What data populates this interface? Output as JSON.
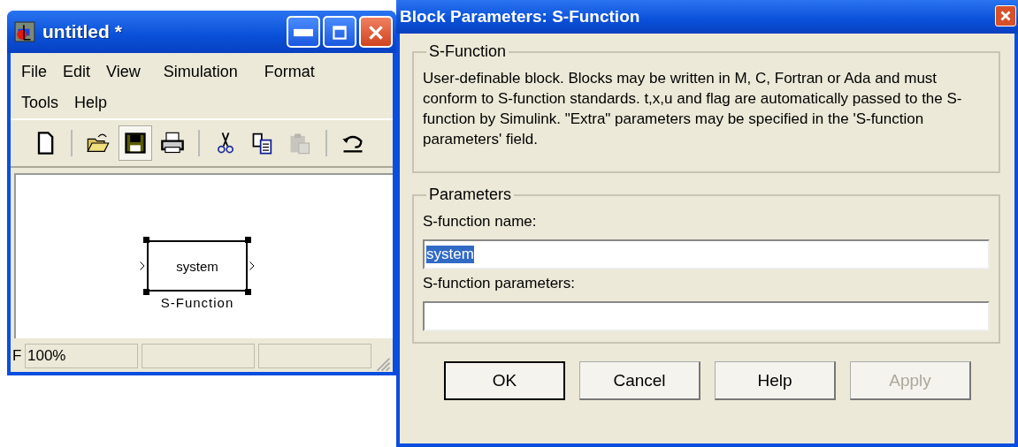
{
  "model_window": {
    "title": "untitled *",
    "menu_rows": [
      [
        "File",
        "Edit",
        "View",
        "Simulation",
        "Format"
      ],
      [
        "Tools",
        "Help"
      ]
    ],
    "toolbar": [
      {
        "kind": "new",
        "pressed": false,
        "disabled": false
      },
      {
        "kind": "separator"
      },
      {
        "kind": "open",
        "pressed": false,
        "disabled": false
      },
      {
        "kind": "save",
        "pressed": true,
        "disabled": false
      },
      {
        "kind": "print",
        "pressed": false,
        "disabled": false
      },
      {
        "kind": "separator"
      },
      {
        "kind": "cut",
        "pressed": false,
        "disabled": false
      },
      {
        "kind": "copy",
        "pressed": false,
        "disabled": false
      },
      {
        "kind": "paste",
        "pressed": false,
        "disabled": true
      },
      {
        "kind": "separator"
      },
      {
        "kind": "undo",
        "pressed": false,
        "disabled": false
      }
    ],
    "block": {
      "text": "system",
      "label": "S-Function",
      "selected": true
    },
    "status_bar": [
      "F",
      "100%"
    ]
  },
  "dialog": {
    "title": "Block Parameters: S-Function",
    "description_group": {
      "legend": "S-Function",
      "text": "User-definable block.  Blocks may be written in M, C, Fortran or Ada and must  conform to S-function standards.  t,x,u and flag are automatically passed to the S-function by Simulink.  \"Extra\" parameters may be specified in the 'S-function parameters' field."
    },
    "parameters_group": {
      "legend": "Parameters",
      "fields": [
        {
          "label": "S-function name:",
          "value": "system",
          "text_selected": true
        },
        {
          "label": "S-function parameters:"
        }
      ]
    },
    "buttons": [
      {
        "label": "OK",
        "default": true,
        "disabled": false
      },
      {
        "label": "Cancel",
        "default": false,
        "disabled": false
      },
      {
        "label": "Help",
        "default": false,
        "disabled": false
      },
      {
        "label": "Apply",
        "default": false,
        "disabled": true
      }
    ]
  }
}
